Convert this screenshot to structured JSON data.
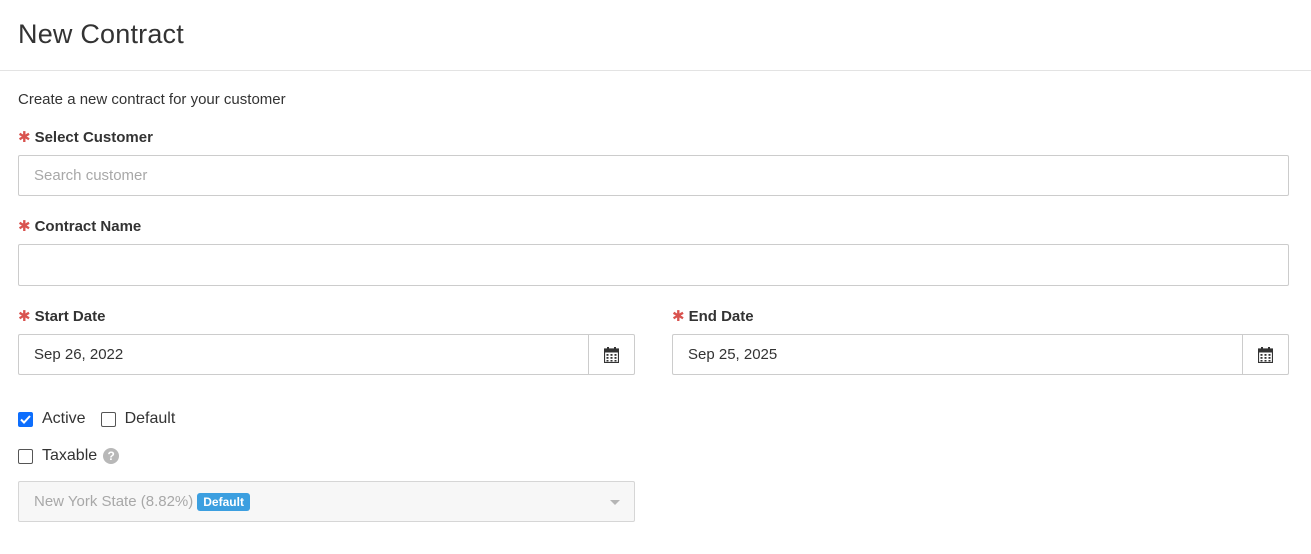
{
  "page": {
    "title": "New Contract",
    "subtitle": "Create a new contract for your customer"
  },
  "form": {
    "required_mark": "✱",
    "customer": {
      "label": "Select Customer",
      "placeholder": "Search customer",
      "value": ""
    },
    "contract_name": {
      "label": "Contract Name",
      "value": ""
    },
    "start_date": {
      "label": "Start Date",
      "value": "Sep 26, 2022"
    },
    "end_date": {
      "label": "End Date",
      "value": "Sep 25, 2025"
    },
    "active": {
      "label": "Active",
      "checked": true
    },
    "default": {
      "label": "Default",
      "checked": false
    },
    "taxable": {
      "label": "Taxable",
      "checked": false,
      "help_icon": "question-circle-icon"
    },
    "tax_rate": {
      "value": "New York State (8.82%)",
      "badge": "Default",
      "disabled": true
    }
  },
  "colors": {
    "required": "#d9534f",
    "checkbox_checked": "#0d6efd",
    "badge": "#3c9fe0"
  }
}
